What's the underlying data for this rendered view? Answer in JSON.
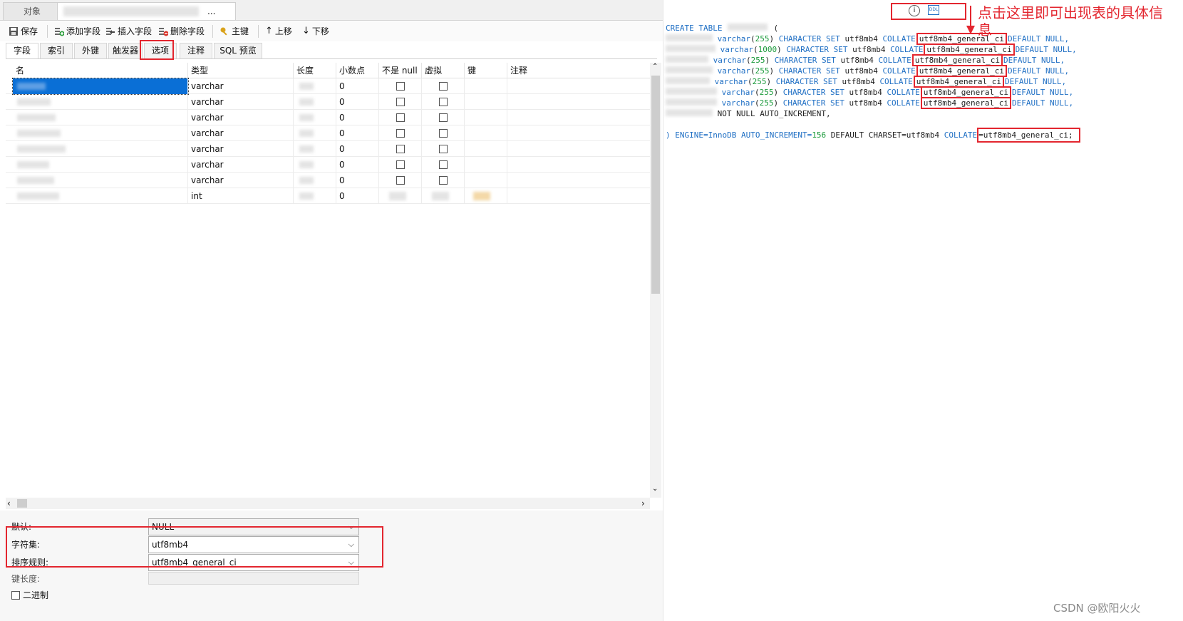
{
  "object_tabs": {
    "objects": "对象",
    "current_suffix": "..."
  },
  "toolbar": {
    "save": "保存",
    "add_field": "添加字段",
    "insert_field": "插入字段",
    "delete_field": "删除字段",
    "primary_key": "主键",
    "move_up": "上移",
    "move_down": "下移"
  },
  "subtabs": [
    "字段",
    "索引",
    "外键",
    "触发器",
    "选项",
    "注释",
    "SQL 预览"
  ],
  "grid": {
    "columns": [
      "名",
      "类型",
      "长度",
      "小数点",
      "不是 null",
      "虚拟",
      "键",
      "注释"
    ],
    "rows": [
      {
        "type": "varchar",
        "decimals": "0"
      },
      {
        "type": "varchar",
        "decimals": "0"
      },
      {
        "type": "varchar",
        "decimals": "0"
      },
      {
        "type": "varchar",
        "decimals": "0"
      },
      {
        "type": "varchar",
        "decimals": "0"
      },
      {
        "type": "varchar",
        "decimals": "0"
      },
      {
        "type": "varchar",
        "decimals": "0"
      },
      {
        "type": "int",
        "decimals": "0"
      }
    ]
  },
  "options": {
    "default_label": "默认:",
    "default_value": "NULL",
    "charset_label": "字符集:",
    "charset_value": "utf8mb4",
    "collation_label": "排序规则:",
    "collation_value": "utf8mb4_general_ci",
    "key_length_label": "键长度:",
    "binary_label": "二进制"
  },
  "ddl": {
    "line0": "CREATE TABLE",
    "paren": "(",
    "col_lines": [
      {
        "type": "varchar",
        "len": "255"
      },
      {
        "type": "varchar",
        "len": "1000"
      },
      {
        "type": "varchar",
        "len": "255"
      },
      {
        "type": "varchar",
        "len": "255"
      },
      {
        "type": "varchar",
        "len": "255"
      },
      {
        "type": "varchar",
        "len": "255"
      },
      {
        "type": "varchar",
        "len": "255"
      }
    ],
    "charset_kw": "CHARACTER SET",
    "charset": "utf8mb4",
    "collate_kw": "COLLATE",
    "collation": "utf8mb4_general_ci",
    "default_null": "DEFAULT NULL,",
    "auto_line": "NOT NULL AUTO_INCREMENT,",
    "engine_line_a": ") ENGINE=InnoDB AUTO_INCREMENT=",
    "auto_value": "156",
    "engine_line_b": " DEFAULT CHARSET=utf8mb4",
    "final_collation": "=utf8mb4_general_ci;"
  },
  "annotation": "点击这里即可出现表的具体信息",
  "watermark": "CSDN @欧阳火火",
  "colors": {
    "accent_red": "#e3262f",
    "selection_blue": "#0a6fd6",
    "keyword_blue": "#1f6fc4"
  }
}
